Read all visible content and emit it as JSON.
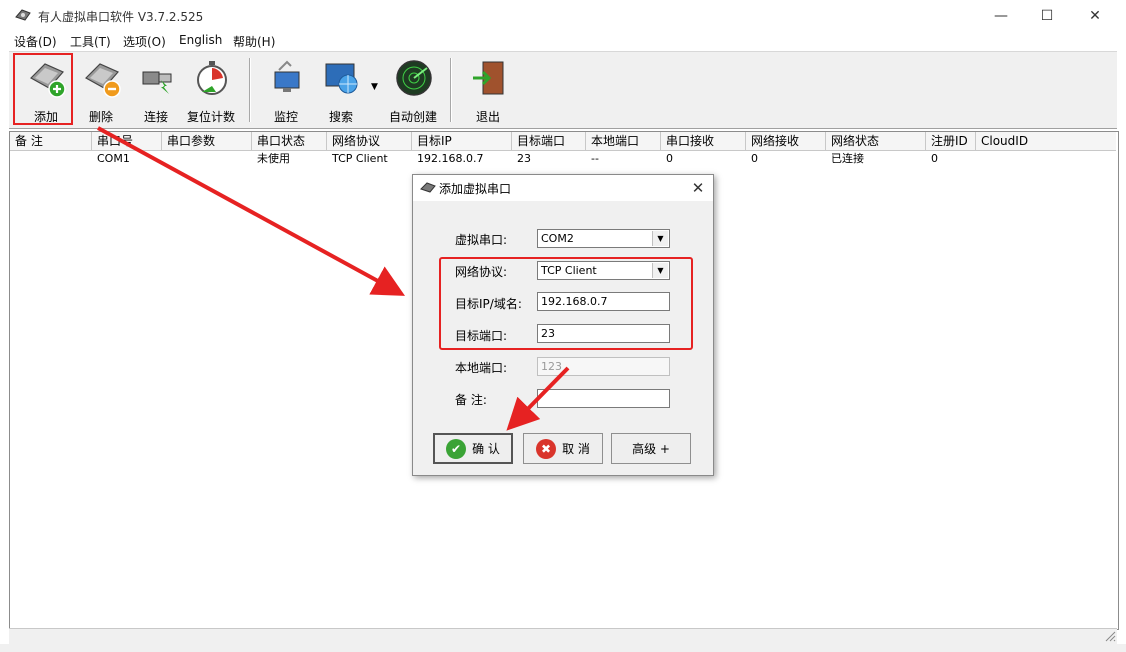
{
  "window": {
    "title": "有人虚拟串口软件 V3.7.2.525",
    "min_icon": "—",
    "max_icon": "☐",
    "close_icon": "✕"
  },
  "menu": [
    "设备(D)",
    "工具(T)",
    "选项(O)",
    "English",
    "帮助(H)"
  ],
  "toolbar": {
    "add": "添加",
    "delete": "删除",
    "connect": "连接",
    "reset_count": "复位计数",
    "monitor": "监控",
    "search": "搜索",
    "auto_create": "自动创建",
    "exit": "退出"
  },
  "table": {
    "headers": [
      "备 注",
      "串口号",
      "串口参数",
      "串口状态",
      "网络协议",
      "目标IP",
      "目标端口",
      "本地端口",
      "串口接收",
      "网络接收",
      "网络状态",
      "注册ID",
      "CloudID"
    ],
    "rows": [
      [
        "",
        "COM1",
        "",
        "未使用",
        "TCP Client",
        "192.168.0.7",
        "23",
        "--",
        "0",
        "0",
        "已连接",
        "0",
        ""
      ]
    ]
  },
  "dialog": {
    "title": "添加虚拟串口",
    "close_icon": "✕",
    "fields": {
      "virtual_port_label": "虚拟串口:",
      "virtual_port_value": "COM2",
      "protocol_label": "网络协议:",
      "protocol_value": "TCP Client",
      "target_ip_label": "目标IP/域名:",
      "target_ip_value": "192.168.0.7",
      "target_port_label": "目标端口:",
      "target_port_value": "23",
      "local_port_label": "本地端口:",
      "local_port_value": "123",
      "remark_label": "备 注:",
      "remark_value": ""
    },
    "buttons": {
      "ok": "确 认",
      "ok_icon": "✔",
      "cancel": "取 消",
      "cancel_icon": "✖",
      "advanced": "高级 +"
    }
  },
  "colors": {
    "highlight": "#e62222",
    "toolbar_bg": "#f0f0f0",
    "ok_icon": "#3aa335",
    "cancel_icon": "#d9342b"
  }
}
